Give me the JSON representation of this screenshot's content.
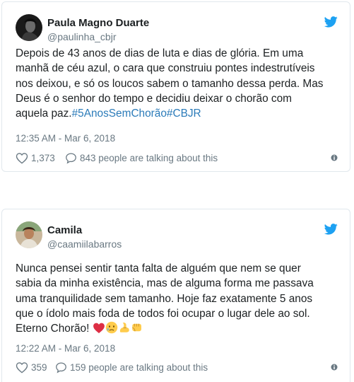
{
  "tweets": [
    {
      "name": "Paula Magno Duarte",
      "handle": "@paulinha_cbjr",
      "text_lines": [
        "Depois de 43 anos de dias de luta e dias de glória. Em uma",
        "manhã de céu azul, o cara que construiu pontes indestrutíveis",
        "nos deixou, e só os loucos sabem o tamanho dessa perda. Mas",
        "Deus é o senhor do tempo e decidiu deixar o chorão com"
      ],
      "last_line_text": "aquela paz.",
      "hashtags": [
        "#5AnosSemChorão",
        "#CBJR"
      ],
      "timestamp": "12:35 AM - Mar 6, 2018",
      "likes": "1,373",
      "talking": "843 people are talking about this"
    },
    {
      "name": "Camila",
      "handle": "@caamiilabarros",
      "text_lines": [
        "Nunca pensei sentir tanta falta de alguém que nem se quer",
        "sabia da minha existência, mas de alguma forma me passava",
        "uma tranquilidade sem tamanho. Hoje faz exatamente 5 anos",
        "que o ídolo mais foda de todos foi ocupar o lugar dele ao sol."
      ],
      "last_line_text": "Eterno Chorão!",
      "emojis": [
        "red-heart",
        "crying-face",
        "flexed-biceps",
        "oncoming-fist"
      ],
      "timestamp": "12:22 AM - Mar 6, 2018",
      "likes": "359",
      "talking": "159 people are talking about this"
    }
  ],
  "colors": {
    "text": "#1c2022",
    "secondary": "#697882",
    "hashtag": "#2b7bb9",
    "twitter_blue": "#1da1f2",
    "border": "#e1e8ed"
  }
}
